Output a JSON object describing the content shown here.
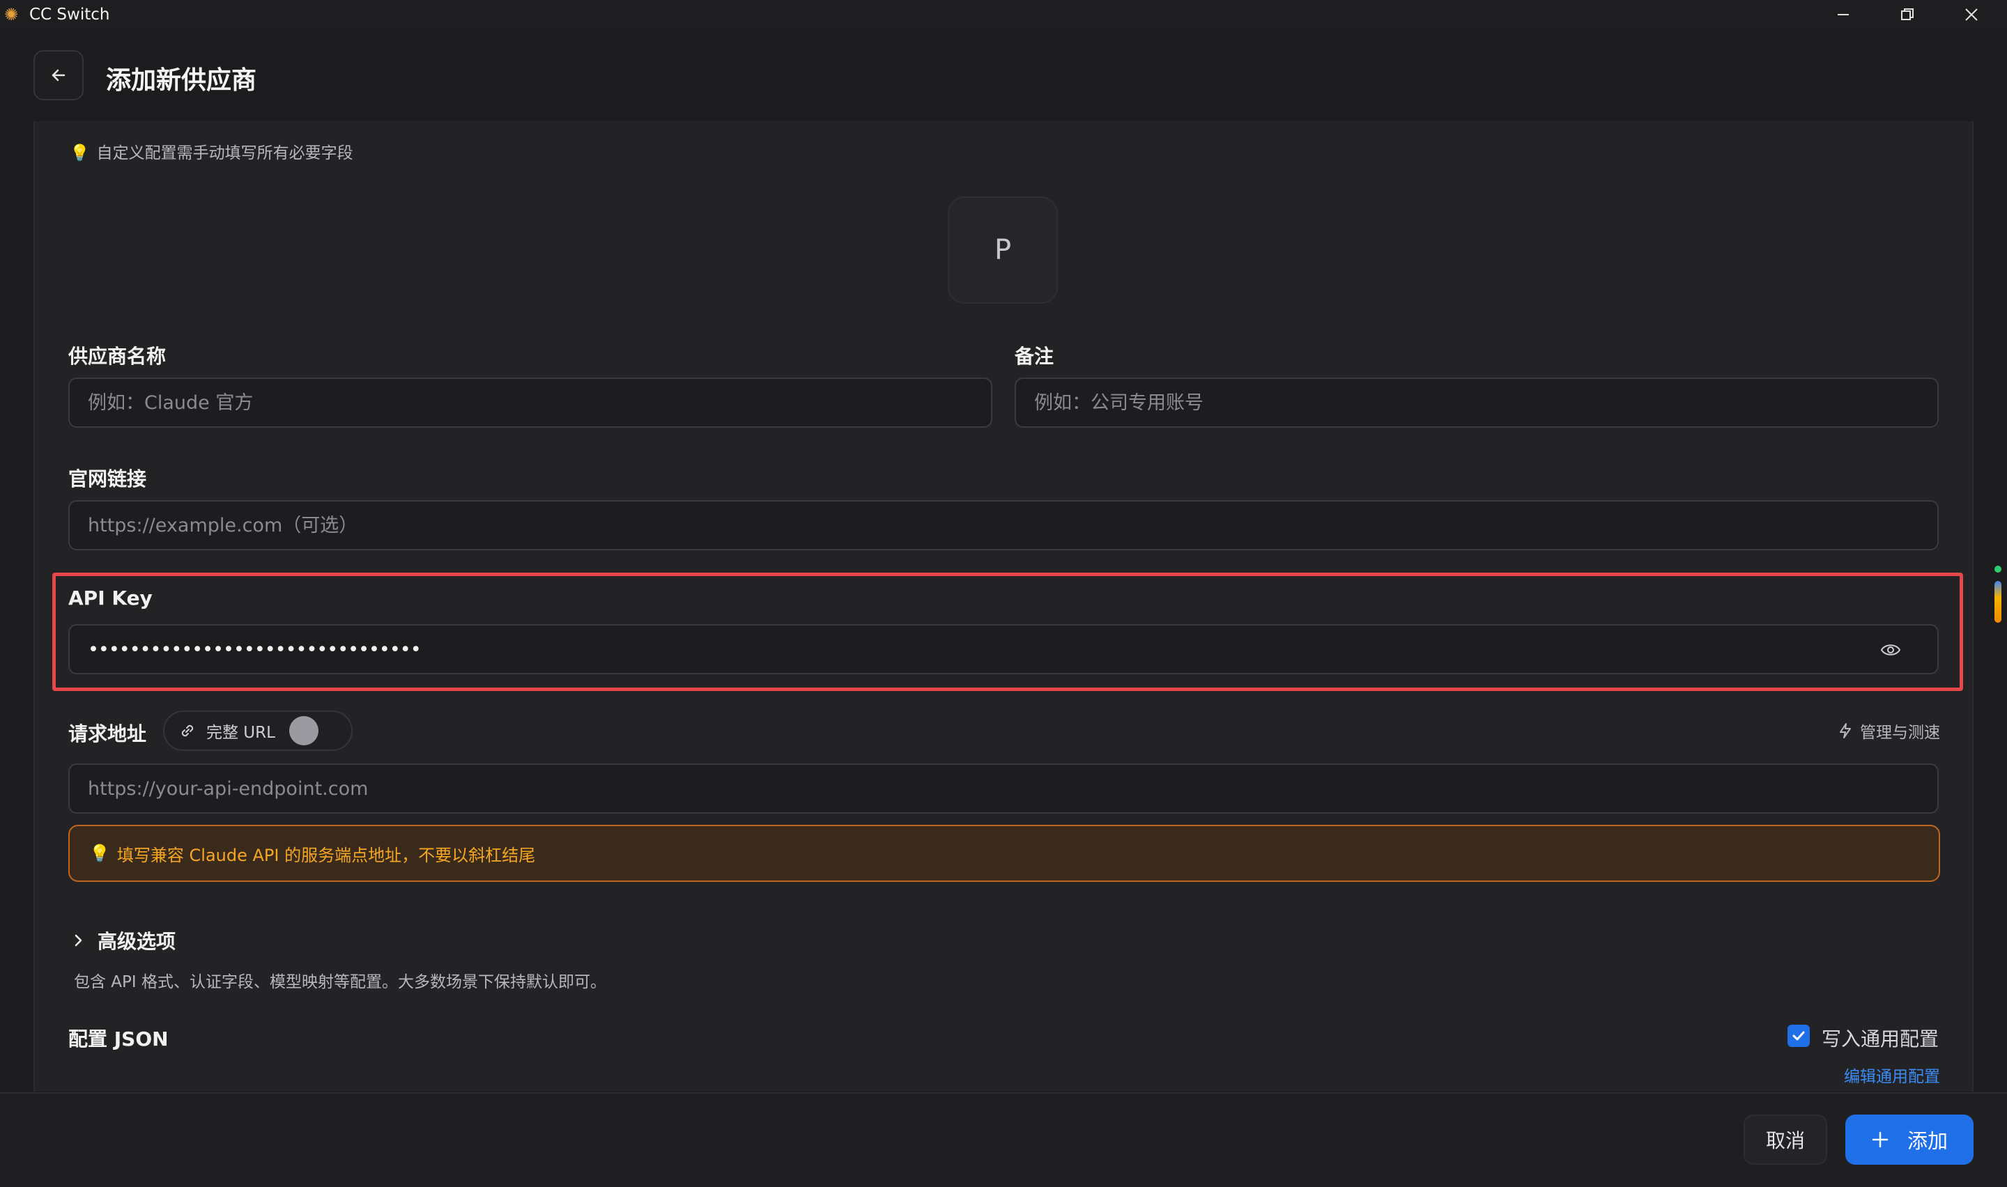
{
  "window": {
    "title": "CC Switch",
    "controls": [
      "minimize",
      "restore",
      "close"
    ]
  },
  "header": {
    "title": "添加新供应商"
  },
  "form": {
    "tip": "自定义配置需手动填写所有必要字段",
    "avatar_letter": "P",
    "provider_name": {
      "label": "供应商名称",
      "placeholder": "例如：Claude 官方"
    },
    "notes": {
      "label": "备注",
      "placeholder": "例如：公司专用账号"
    },
    "website": {
      "label": "官网链接",
      "placeholder": "https://example.com（可选）"
    },
    "api_key": {
      "label": "API Key",
      "masked_value": "••••••••••••••••••••••••••••••••"
    },
    "endpoint": {
      "label": "请求地址",
      "full_url_toggle_label": "完整 URL",
      "full_url_enabled": false,
      "manage_label": "管理与测速",
      "placeholder": "https://your-api-endpoint.com",
      "warning": "填写兼容 Claude API 的服务端点地址，不要以斜杠结尾"
    },
    "advanced": {
      "label": "高级选项",
      "description": "包含 API 格式、认证字段、模型映射等配置。大多数场景下保持默认即可。"
    },
    "json_config": {
      "label": "配置 JSON",
      "write_common_label": "写入通用配置",
      "write_common_checked": true,
      "edit_common_link": "编辑通用配置"
    }
  },
  "footer": {
    "cancel_label": "取消",
    "add_label": "添加"
  },
  "colors": {
    "accent": "#1e6fe8",
    "highlight": "#e5474b",
    "warning": "#f5a623"
  }
}
